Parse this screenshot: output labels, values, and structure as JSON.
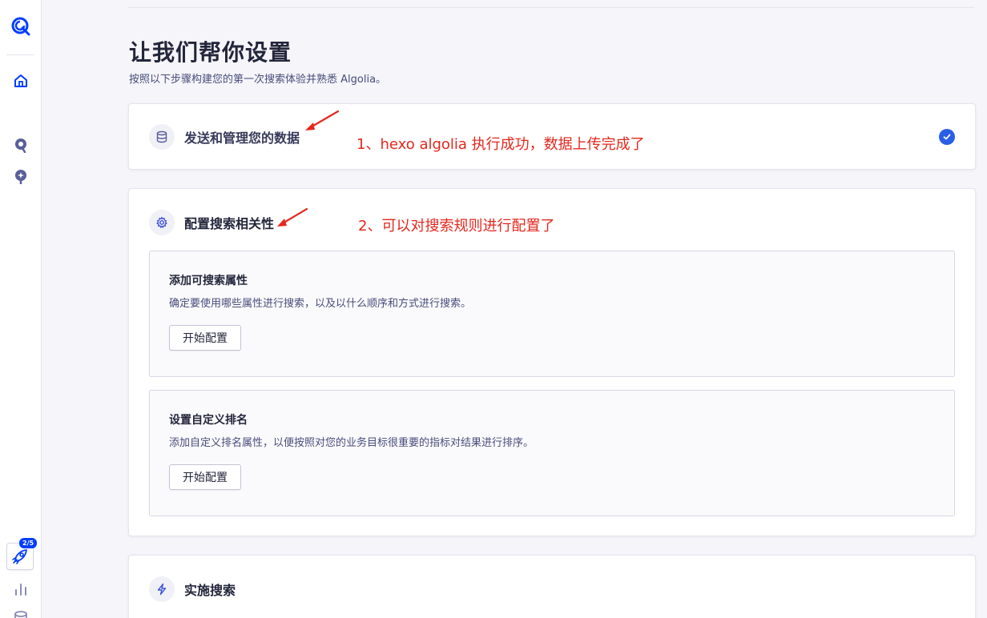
{
  "sidebar": {
    "onboarding_badge": "2/5"
  },
  "header": {
    "title": "让我们帮你设置",
    "subtitle": "按照以下步骤构建您的第一次搜索体验并熟悉 Algolia。"
  },
  "steps": [
    {
      "title": "发送和管理您的数据",
      "icon": "database-icon",
      "completed": true
    },
    {
      "title": "配置搜索相关性",
      "icon": "gear-icon",
      "tasks": [
        {
          "title": "添加可搜索属性",
          "description": "确定要使用哪些属性进行搜索，以及以什么顺序和方式进行搜索。",
          "button": "开始配置"
        },
        {
          "title": "设置自定义排名",
          "description": "添加自定义排名属性，以便按照对您的业务目标很重要的指标对结果进行排序。",
          "button": "开始配置"
        }
      ]
    },
    {
      "title": "实施搜索",
      "icon": "lightning-icon"
    }
  ],
  "annotations": [
    "1、hexo algolia 执行成功，数据上传完成了",
    "2、可以对搜索规则进行配置了"
  ],
  "colors": {
    "accent": "#003dff",
    "check": "#2a5ee8",
    "annotation": "#e5271d"
  }
}
